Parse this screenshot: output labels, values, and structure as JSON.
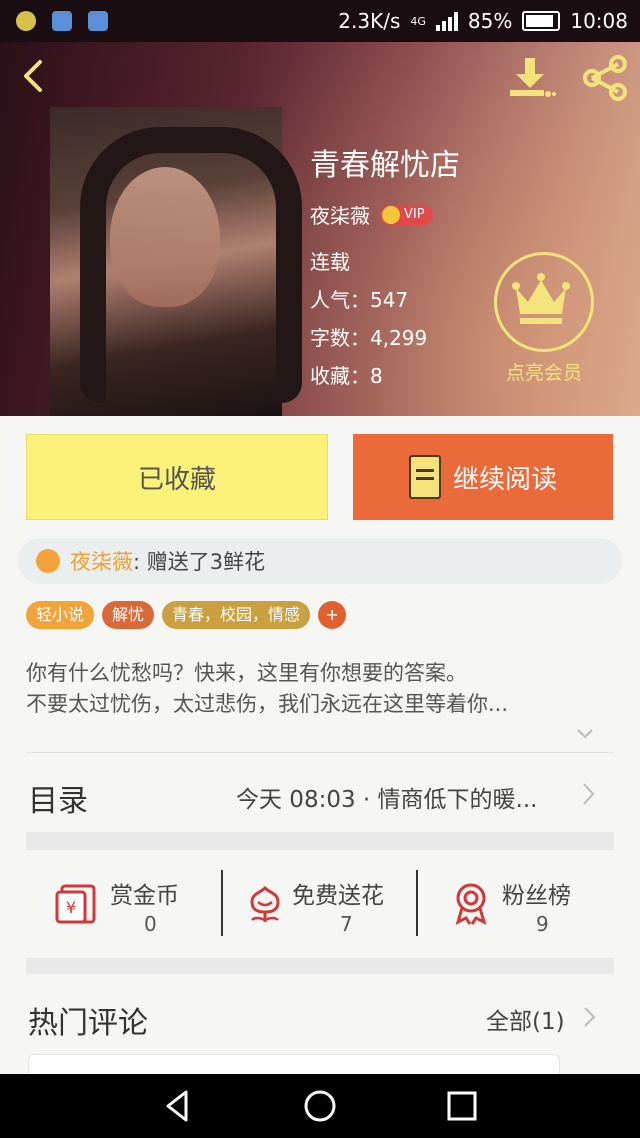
{
  "status_bar": {
    "speed": "2.3K/s",
    "network": "4G",
    "battery": "85%",
    "time": "10:08"
  },
  "book": {
    "title": "青春解忧店",
    "author": "夜柒薇",
    "vip_label": "VIP",
    "status": "连载",
    "popularity": "人气：547",
    "word_count": "字数：4,299",
    "favorites": "收藏：8"
  },
  "vip_promo": {
    "label": "点亮会员"
  },
  "actions": {
    "favorited_label": "已收藏",
    "continue_label": "继续阅读"
  },
  "gift": {
    "user": "夜柒薇",
    "text": ": 赠送了3鲜花"
  },
  "tags": [
    "轻小说",
    "解忧",
    "青春，校园，情感",
    "+"
  ],
  "description": [
    "你有什么忧愁吗？快来，这里有你想要的答案。",
    "不要太过忧伤，太过悲伤，我们永远在这里等着你..."
  ],
  "toc": {
    "label": "目录",
    "latest": "今天 08:03 · 情商低下的暖..."
  },
  "stats": [
    {
      "label": "赏金币",
      "value": "0"
    },
    {
      "label": "免费送花",
      "value": "7"
    },
    {
      "label": "粉丝榜",
      "value": "9"
    }
  ],
  "hot_comments": {
    "label": "热门评论",
    "all": "全部(1)"
  },
  "colors": {
    "accent_yellow": "#fcf27a",
    "accent_orange": "#ea6a3a",
    "gold": "#f4e37a",
    "red_icon": "#d0383a"
  }
}
